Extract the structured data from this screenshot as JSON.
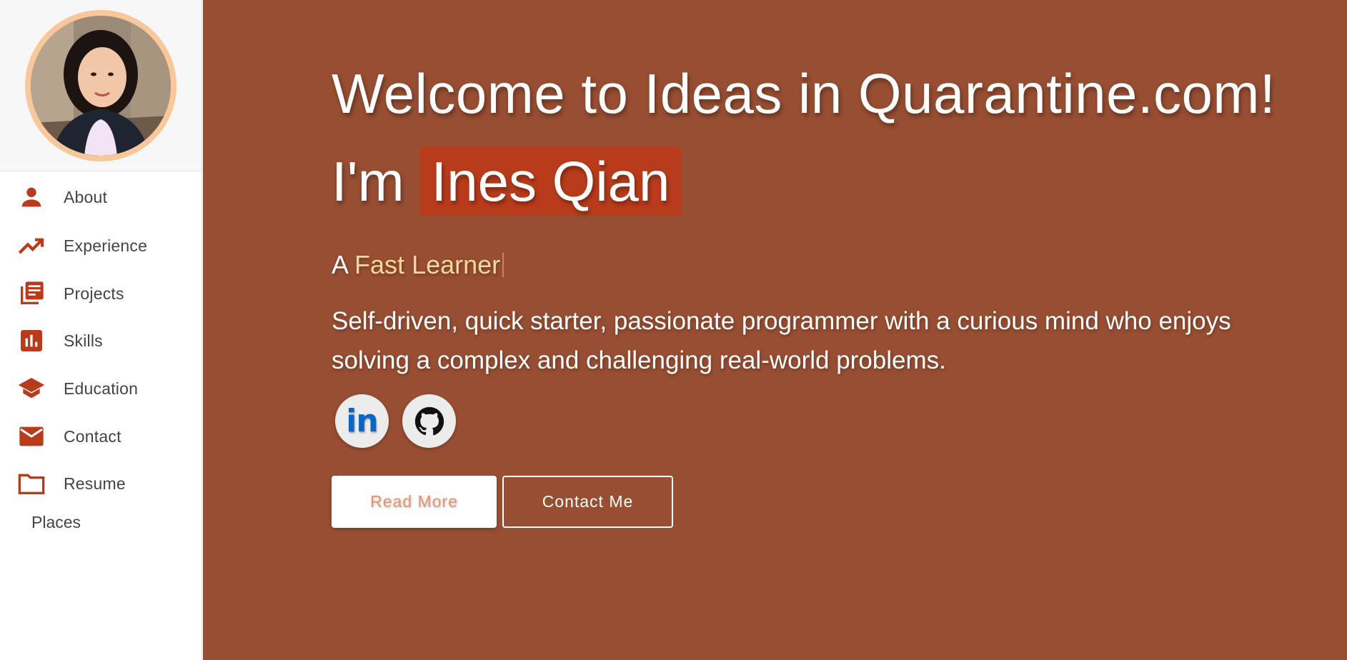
{
  "sidebar": {
    "profile_photo": "profile-photo",
    "items": [
      {
        "label": "About",
        "icon": "person-icon"
      },
      {
        "label": "Experience",
        "icon": "trending-up-icon"
      },
      {
        "label": "Projects",
        "icon": "library-books-icon"
      },
      {
        "label": "Skills",
        "icon": "bar-chart-icon"
      },
      {
        "label": "Education",
        "icon": "graduation-cap-icon"
      },
      {
        "label": "Contact",
        "icon": "mail-icon"
      },
      {
        "label": "Resume",
        "icon": "folder-icon"
      }
    ],
    "extra_link": "Places"
  },
  "hero": {
    "title": "Welcome to Ideas in Quarantine.com!",
    "im_prefix": "I'm",
    "name": "Ines Qian",
    "tagline_prefix": "A",
    "tagline_typed": "Fast Learner",
    "description": "Self-driven, quick starter, passionate programmer with a curious mind who enjoys solving a complex and challenging real-world problems.",
    "social": [
      {
        "name": "linkedin",
        "label": "in",
        "icon": "linkedin-icon"
      },
      {
        "name": "github",
        "icon": "github-icon"
      }
    ],
    "read_more_label": "Read More",
    "contact_me_label": "Contact Me"
  },
  "colors": {
    "accent": "#b83c1c",
    "main_bg": "#974e32",
    "tagline_accent": "#fbd79e",
    "icon": "#b83c1c"
  }
}
